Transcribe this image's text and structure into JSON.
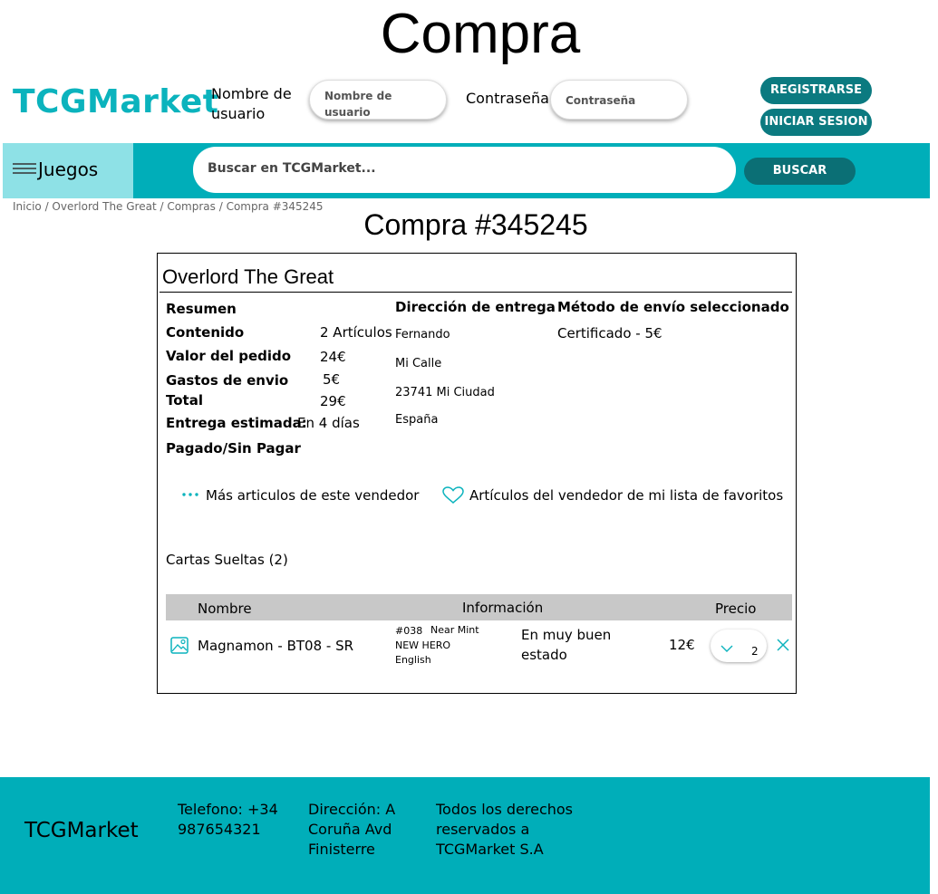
{
  "page": {
    "heading": "Compra"
  },
  "header": {
    "logo": "TCGMarket",
    "username_label": "Nombre de usuario",
    "username_placeholder": "Nombre de usuario",
    "password_label": "Contraseña:",
    "password_placeholder": "Contraseña",
    "register_label": "REGISTRARSE",
    "login_label": "INICIAR SESION"
  },
  "nav": {
    "games_label": "Juegos",
    "search_placeholder": "Buscar en TCGMarket...",
    "search_button": "BUSCAR"
  },
  "breadcrumb": "Inicio / Overlord The Great / Compras / Compra #345245",
  "order": {
    "title": "Compra #345245",
    "seller": "Overlord The Great",
    "summary": {
      "heading": "Resumen",
      "contents_label": "Contenido",
      "contents_value": "2 Artículos",
      "order_value_label": "Valor del pedido",
      "order_value": "24€",
      "shipping_label": "Gastos de envio",
      "shipping_value": "5€",
      "total_label": "Total",
      "total_value": "29€",
      "eta_label": "Entrega estimada:",
      "eta_value": "En 4 días",
      "paid_status": "Pagado/Sin Pagar"
    },
    "address": {
      "heading": "Dirección de entrega",
      "name": "Fernando",
      "street": "Mi Calle",
      "city": "23741 Mi Ciudad",
      "country": "España"
    },
    "shipping_method": {
      "heading": "Método de envío seleccionado",
      "value": "Certificado - 5€"
    },
    "links": {
      "more_items": "Más articulos de este vendedor",
      "favorites": "Artículos del vendedor de mi lista de favoritos"
    },
    "section_title": "Cartas Sueltas (2)",
    "table": {
      "headers": [
        "Nombre",
        "Información",
        "Precio"
      ],
      "rows": [
        {
          "name": "Magnamon - BT08 - SR",
          "number": "#038",
          "condition": "Near Mint",
          "set": "NEW HERO",
          "language": "English",
          "comment": "En muy buen estado",
          "price": "12€",
          "quantity": "2"
        }
      ]
    }
  },
  "footer": {
    "brand": "TCGMarket",
    "phone": "Telefono: +34 987654321",
    "address": "Dirección: A Coruña Avd Finisterre",
    "rights": "Todos los derechos reservados a TCGMarket S.A"
  },
  "colors": {
    "accent": "#00aeb9",
    "accent_light": "#8ee1e6",
    "button_dark": "#0b7a80",
    "logo": "#0bb3bd"
  }
}
